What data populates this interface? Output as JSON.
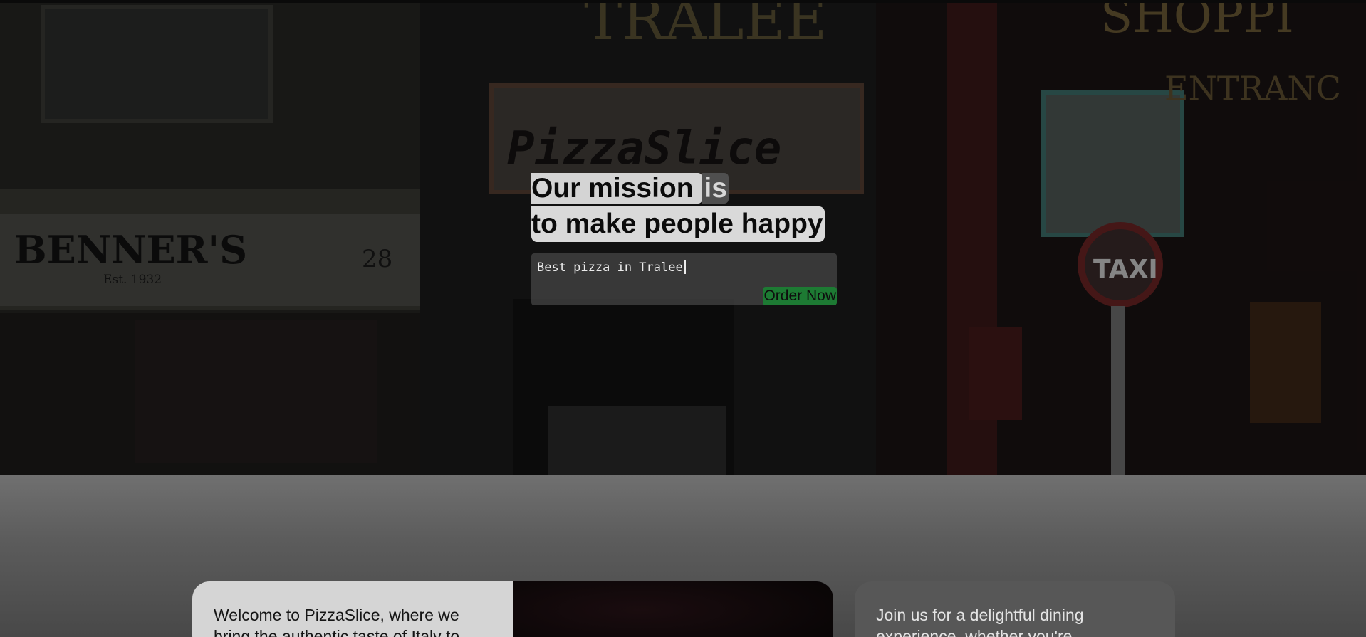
{
  "hero": {
    "storefront_sign": "PizzaSlice",
    "left_sign": "BENNER'S",
    "left_sign_sub": "Est. 1932",
    "left_sign_number": "28",
    "top_sign": "TRALEE",
    "right_sign": "SHOPPI",
    "right_sign_sub": "ENTRANC",
    "taxi_sign": "TAXI",
    "headline_part1": "Our mission ",
    "headline_part2": "is",
    "headline_line2": "to make people happy",
    "prompt_text": "Best pizza in Tralee",
    "order_button_label": "Order Now"
  },
  "about": {
    "text": "Welcome to PizzaSlice, where we bring the authentic taste of Italy to"
  },
  "join": {
    "text": "Join us for a delightful dining experience, whether you're"
  },
  "colors": {
    "accent_green": "#1d7a33",
    "highlight_gray": "#d4d4d4"
  }
}
